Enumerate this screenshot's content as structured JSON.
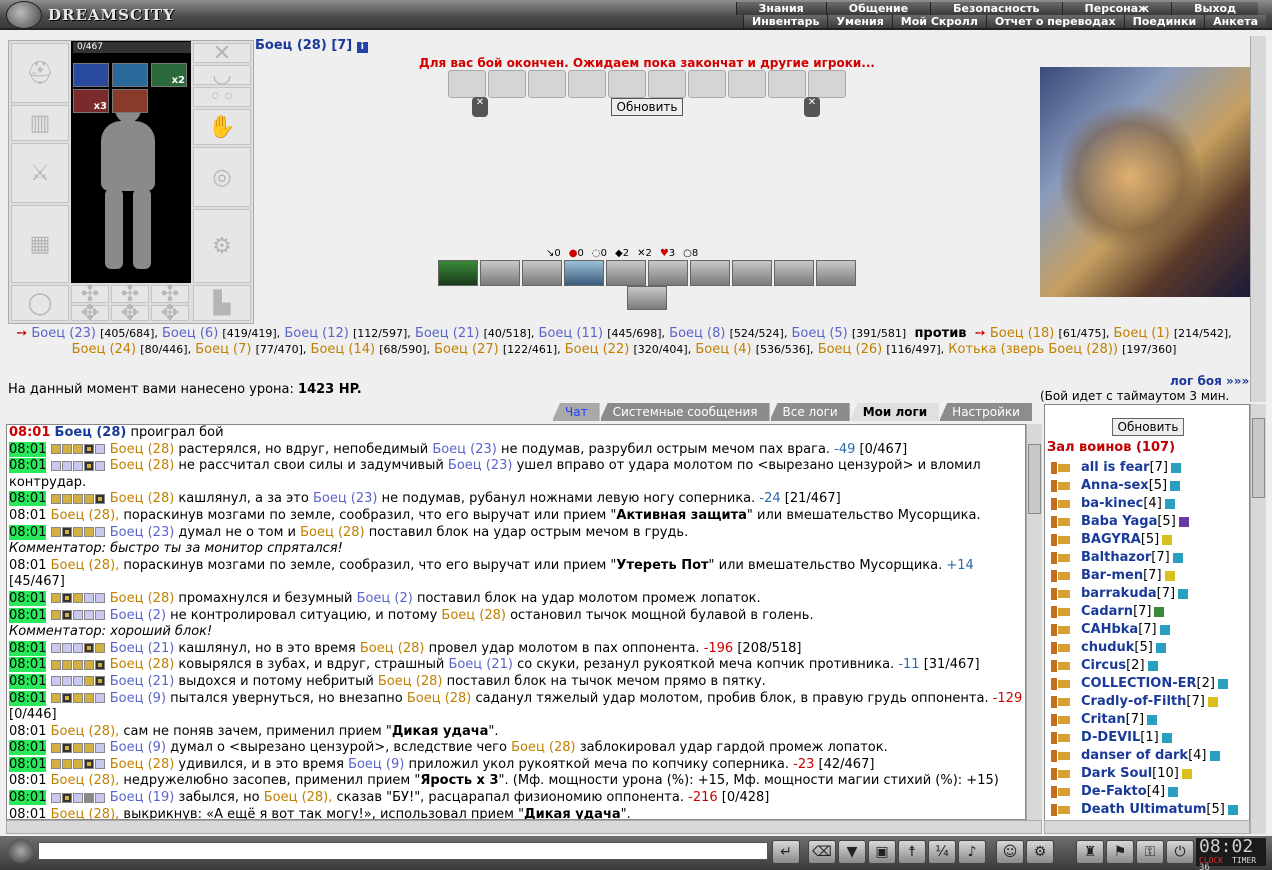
{
  "header": {
    "logo": "DREAMSCITY",
    "menu_top": [
      "Знания",
      "Общение",
      "Безопасность",
      "Персонаж",
      "Выход"
    ],
    "menu_bottom": [
      "Инвентарь",
      "Умения",
      "Мой Скролл",
      "Отчет о переводах",
      "Поединки",
      "Анкета"
    ]
  },
  "inventory": {
    "hp": "0/467",
    "item_counts": [
      "x2",
      "x3"
    ]
  },
  "fighter": {
    "name": "Боец (28) [7]",
    "info": "i"
  },
  "battle": {
    "status": "Для вас бой окончен. Ожидаем пока закончат и другие игроки...",
    "refresh_label": "Обновить",
    "counts": [
      "0",
      "0",
      "0",
      "2",
      "2",
      "3",
      "8"
    ],
    "team_a": [
      {
        "name": "Боец (23)",
        "hp": "[405/684],"
      },
      {
        "name": "Боец (6)",
        "hp": "[419/419],"
      },
      {
        "name": "Боец (12)",
        "hp": "[112/597],"
      },
      {
        "name": "Боец (21)",
        "hp": "[40/518],"
      },
      {
        "name": "Боец (11)",
        "hp": "[445/698],"
      },
      {
        "name": "Боец (8)",
        "hp": "[524/524],"
      },
      {
        "name": "Боец (5)",
        "hp": "[391/581]"
      }
    ],
    "versus": "против",
    "team_b": [
      {
        "name": "Боец (18)",
        "hp": "[61/475],"
      },
      {
        "name": "Боец (1)",
        "hp": "[214/542],"
      },
      {
        "name": "Боец (24)",
        "hp": "[80/446],"
      },
      {
        "name": "Боец (7)",
        "hp": "[77/470],"
      },
      {
        "name": "Боец (14)",
        "hp": "[68/590],"
      },
      {
        "name": "Боец (27)",
        "hp": "[122/461],"
      },
      {
        "name": "Боец (22)",
        "hp": "[320/404],"
      },
      {
        "name": "Боец (4)",
        "hp": "[536/536],"
      },
      {
        "name": "Боец (26)",
        "hp": "[116/497],"
      },
      {
        "name": "Котька (зверь Боец (28))",
        "hp": "[197/360]"
      }
    ],
    "damage_label": "На данный момент вами нанесено урона:",
    "damage_value": "1423 HP.",
    "log_link": "лог боя »»»",
    "timeout": "(Бой идет с таймаутом 3 мин."
  },
  "tabs": [
    {
      "label": "Чат",
      "state": "chat"
    },
    {
      "label": "Системные сообщения",
      "state": ""
    },
    {
      "label": "Все логи",
      "state": ""
    },
    {
      "label": "Мои логи",
      "state": "active"
    },
    {
      "label": "Настройки",
      "state": ""
    }
  ],
  "log": {
    "time": "08:01",
    "l1_name": "Боец (28)",
    "l1_text": " проиграл бой",
    "l2_a": "Боец (28)",
    "l2_t1": " растерялся, но вдруг, непобедимый ",
    "l2_b": "Боец (23)",
    "l2_t2": " не подумав, разрубил острым мечом пах врага. ",
    "l2_dmg": "-49",
    "l2_hp": " [0/467]",
    "l3_a": "Боец (28)",
    "l3_t1": " не рассчитал свои силы и задумчивый ",
    "l3_b": "Боец (23)",
    "l3_t2": " ушел вправо от удара молотом по <вырезано цензурой> и вломил контрудар.",
    "l4_a": "Боец (28)",
    "l4_t1": " кашлянул, а за это ",
    "l4_b": "Боец (23)",
    "l4_t2": " не подумав, рубанул ножнами левую ногу соперника. ",
    "l4_dmg": "-24",
    "l4_hp": " [21/467]",
    "l5_a": "Боец (28),",
    "l5_t1": " пораскинув мозгами по земле, сообразил, что его выручат или прием \"",
    "l5_hl": "Активная защита",
    "l5_t2": "\" или вмешательство Мусорщика.",
    "l6_a": "Боец (23)",
    "l6_t1": " думал не о том и ",
    "l6_b": "Боец (28)",
    "l6_t2": " поставил блок на удар острым мечом в грудь.",
    "c1": "Комментатор: быстро ты за монитор спрятался!",
    "l7_a": "Боец (28),",
    "l7_t1": " пораскинув мозгами по земле, сообразил, что его выручат или прием \"",
    "l7_hl": "Утереть Пот",
    "l7_t2": "\" или вмешательство Мусорщика. ",
    "l7_dmg": "+14",
    "l7_hp": " [45/467]",
    "l8_a": "Боец (28)",
    "l8_t1": " промахнулся и безумный ",
    "l8_b": "Боец (2)",
    "l8_t2": " поставил блок на удар молотом промеж лопаток.",
    "l9_a": "Боец (2)",
    "l9_t1": " не контролировал ситуацию, и потому ",
    "l9_b": "Боец (28)",
    "l9_t2": " остановил тычок мощной булавой в голень.",
    "c2": "Комментатор: хороший блок!",
    "l10_a": "Боец (21)",
    "l10_t1": " кашлянул, но в это время ",
    "l10_b": "Боец (28)",
    "l10_t2": " провел удар молотом в пах оппонента. ",
    "l10_dmg": "-196",
    "l10_hp": " [208/518]",
    "l11_a": "Боец (28)",
    "l11_t1": " ковырялся в зубах, и вдруг, страшный ",
    "l11_b": "Боец (21)",
    "l11_t2": " со скуки, резанул рукояткой меча копчик противника. ",
    "l11_dmg": "-11",
    "l11_hp": " [31/467]",
    "l12_a": "Боец (21)",
    "l12_t1": " выдохся и потому небритый ",
    "l12_b": "Боец (28)",
    "l12_t2": " поставил блок на тычок мечом прямо в пятку.",
    "l13_a": "Боец (9)",
    "l13_t1": " пытался увернуться, но внезапно ",
    "l13_b": "Боец (28)",
    "l13_t2": " саданул тяжелый удар молотом, пробив блок, в правую грудь оппонента. ",
    "l13_dmg": "-129",
    "l13_hp": " [0/446]",
    "l14_a": "Боец (28),",
    "l14_t1": " сам не поняв зачем, применил прием \"",
    "l14_hl": "Дикая удача",
    "l14_t2": "\".",
    "l15_a": "Боец (9)",
    "l15_t1": " думал о <вырезано цензурой>, вследствие чего ",
    "l15_b": "Боец (28)",
    "l15_t2": " заблокировал удар гардой промеж лопаток.",
    "l16_a": "Боец (28)",
    "l16_t1": " удивился, и в это время ",
    "l16_b": "Боец (9)",
    "l16_t2": " приложил укол рукояткой меча по копчику соперника. ",
    "l16_dmg": "-23",
    "l16_hp": " [42/467]",
    "l17_a": "Боец (28),",
    "l17_t1": " недружелюбно засопев, применил прием \"",
    "l17_hl": "Ярость x 3",
    "l17_t2": "\". (Мф. мощности урона (%): +15, Мф. мощности магии стихий (%): +15)",
    "l18_a": "Боец (19)",
    "l18_t1": " забылся, но ",
    "l18_b": "Боец (28),",
    "l18_t2": " сказав \"БУ!\", расцарапал физиономию оппонента. ",
    "l18_dmg": "-216",
    "l18_hp": " [0/428]",
    "l19_a": "Боец (28),",
    "l19_t1": " выкрикнув: «А ещё я вот так могу!», использовал прием \"",
    "l19_hl": "Дикая удача",
    "l19_t2": "\"."
  },
  "hall": {
    "refresh_label": "Обновить",
    "title": "Зал воинов (107)",
    "players": [
      {
        "name": "all is fear",
        "lvl": "[7]",
        "c": "b"
      },
      {
        "name": "Anna-sex",
        "lvl": "[5]",
        "c": "b"
      },
      {
        "name": "ba-kinec",
        "lvl": "[4]",
        "c": "b"
      },
      {
        "name": "Baba Yaga",
        "lvl": "[5]",
        "c": "v"
      },
      {
        "name": "BAGYRA",
        "lvl": "[5]",
        "c": "y"
      },
      {
        "name": "Balthazor",
        "lvl": "[7]",
        "c": "b"
      },
      {
        "name": "Bar-men",
        "lvl": "[7]",
        "c": "y"
      },
      {
        "name": "barrakuda",
        "lvl": "[7]",
        "c": "b"
      },
      {
        "name": "Cadarn",
        "lvl": "[7]",
        "c": "g"
      },
      {
        "name": "CAHbka",
        "lvl": "[7]",
        "c": "b"
      },
      {
        "name": "chuduk",
        "lvl": "[5]",
        "c": "b"
      },
      {
        "name": "Circus",
        "lvl": "[2]",
        "c": "b"
      },
      {
        "name": "COLLECTION-ER",
        "lvl": "[2]",
        "c": "b"
      },
      {
        "name": "Cradly-of-Filth",
        "lvl": "[7]",
        "c": "y"
      },
      {
        "name": "Critan",
        "lvl": "[7]",
        "c": "b"
      },
      {
        "name": "D-DEVIL",
        "lvl": "[1]",
        "c": "b"
      },
      {
        "name": "danser of dark",
        "lvl": "[4]",
        "c": "b"
      },
      {
        "name": "Dark Soul",
        "lvl": "[10]",
        "c": "y"
      },
      {
        "name": "De-Fakto",
        "lvl": "[4]",
        "c": "b"
      },
      {
        "name": "Death Ultimatum",
        "lvl": "[5]",
        "c": "b"
      }
    ]
  },
  "clock": {
    "time": "08:02",
    "sec": "36",
    "l1": "CLOCK",
    "l2": "TIMER"
  }
}
